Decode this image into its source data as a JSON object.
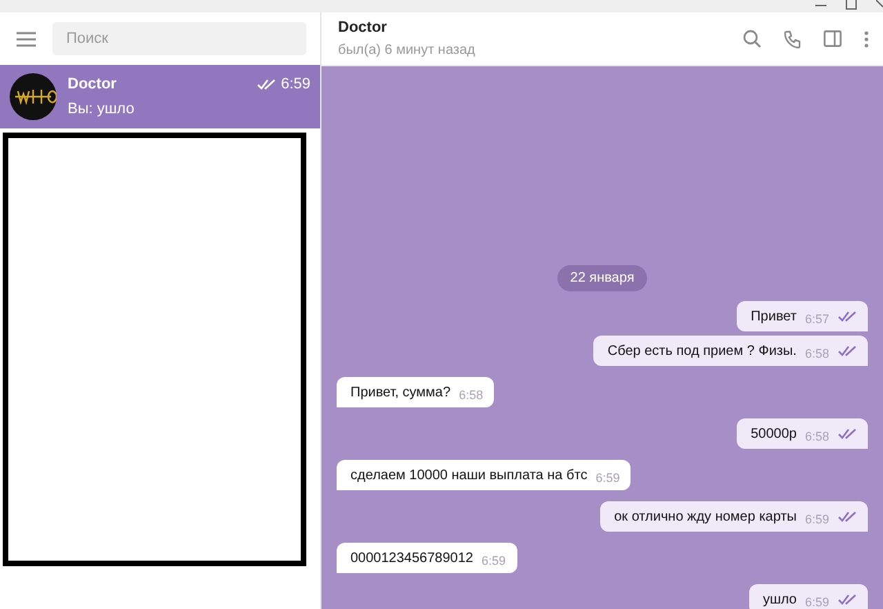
{
  "search": {
    "placeholder": "Поиск"
  },
  "chats": [
    {
      "name": "Doctor",
      "time": "6:59",
      "preview": "Вы: ушло",
      "read": true,
      "selected": true
    }
  ],
  "chat_header": {
    "name": "Doctor",
    "status": "был(а) 6 минут назад"
  },
  "date_pill": "22 января",
  "messages": [
    {
      "kind": "out",
      "text": "Привет",
      "time": "6:57",
      "read": true
    },
    {
      "kind": "out",
      "text": "Сбер есть под прием ? Физы.",
      "time": "6:58",
      "read": true
    },
    {
      "kind": "in",
      "text": "Привет, сумма?",
      "time": "6:58"
    },
    {
      "kind": "out",
      "text": "50000р",
      "time": "6:58",
      "read": true
    },
    {
      "kind": "in",
      "text": "сделаем 10000 наши выплата на бтс",
      "time": "6:59"
    },
    {
      "kind": "out",
      "text": "ок отлично жду номер карты",
      "time": "6:59",
      "read": true
    },
    {
      "kind": "in",
      "text": "0000123456789012",
      "time": "6:59"
    },
    {
      "kind": "out",
      "text": "ушло",
      "time": "6:59",
      "read": true
    }
  ]
}
